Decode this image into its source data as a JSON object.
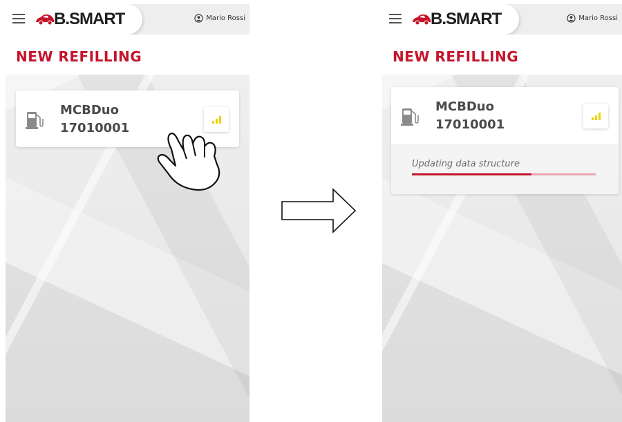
{
  "app": {
    "brand": "B.SMART",
    "user_name": "Mario Rossi",
    "page_title": "NEW REFILLING"
  },
  "device": {
    "model": "MCBDuo",
    "serial": "17010001"
  },
  "update": {
    "status_text": "Updating data structure",
    "progress": 0.65
  },
  "icons": {
    "menu": "hamburger-menu-icon",
    "brand_mark": "car-logo-icon",
    "user": "user-circle-icon",
    "pump": "fuel-pump-icon",
    "signal": "signal-strength-icon",
    "hand": "tap-hand-icon",
    "arrow": "right-arrow-icon"
  },
  "colors": {
    "accent": "#c4142b",
    "signal": "#f0d000"
  }
}
